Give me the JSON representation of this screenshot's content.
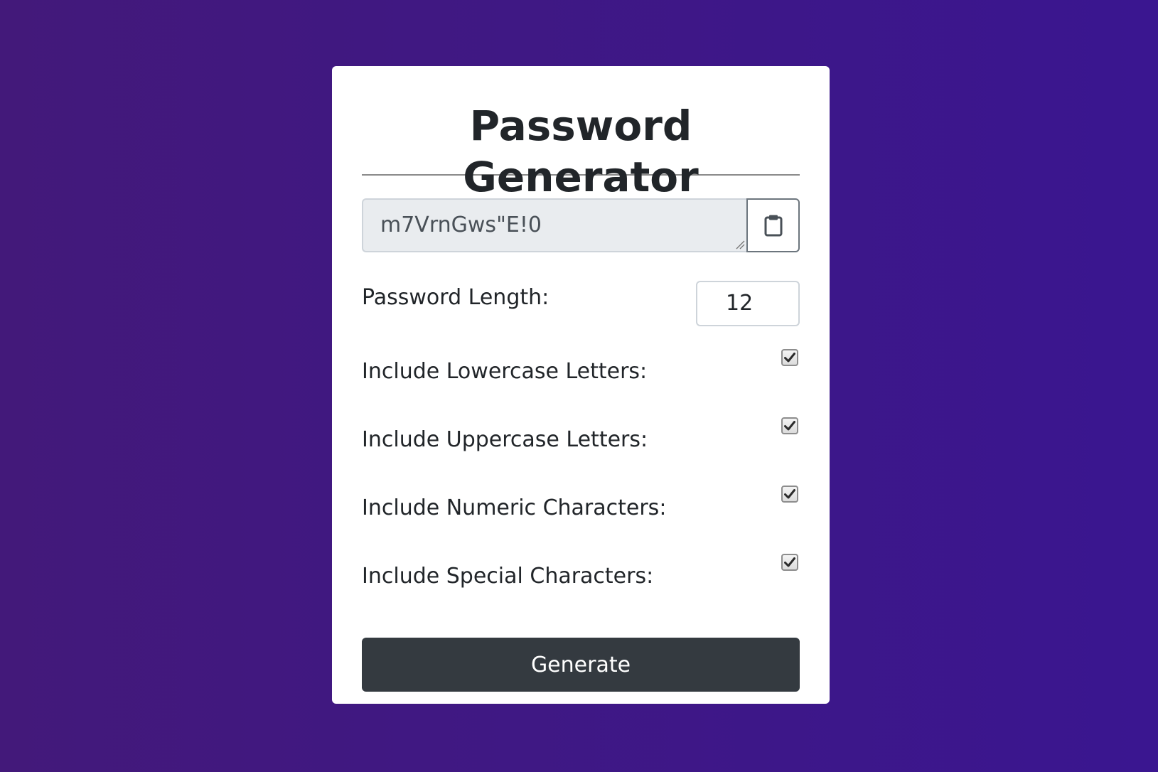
{
  "header": {
    "title": "Password Generator"
  },
  "output": {
    "value": "m7VrnGws\"E!0",
    "copy_icon": "clipboard-icon"
  },
  "length": {
    "label": "Password Length:",
    "value": "12"
  },
  "options": [
    {
      "label": "Include Lowercase Letters:",
      "checked": true
    },
    {
      "label": "Include Uppercase Letters:",
      "checked": true
    },
    {
      "label": "Include Numeric Characters:",
      "checked": true
    },
    {
      "label": "Include Special Characters:",
      "checked": true
    }
  ],
  "generate": {
    "label": "Generate"
  },
  "colors": {
    "background_start": "#43197a",
    "background_end": "#3a1690",
    "card": "#ffffff",
    "button": "#343a40",
    "output_field": "#e9ecef"
  }
}
